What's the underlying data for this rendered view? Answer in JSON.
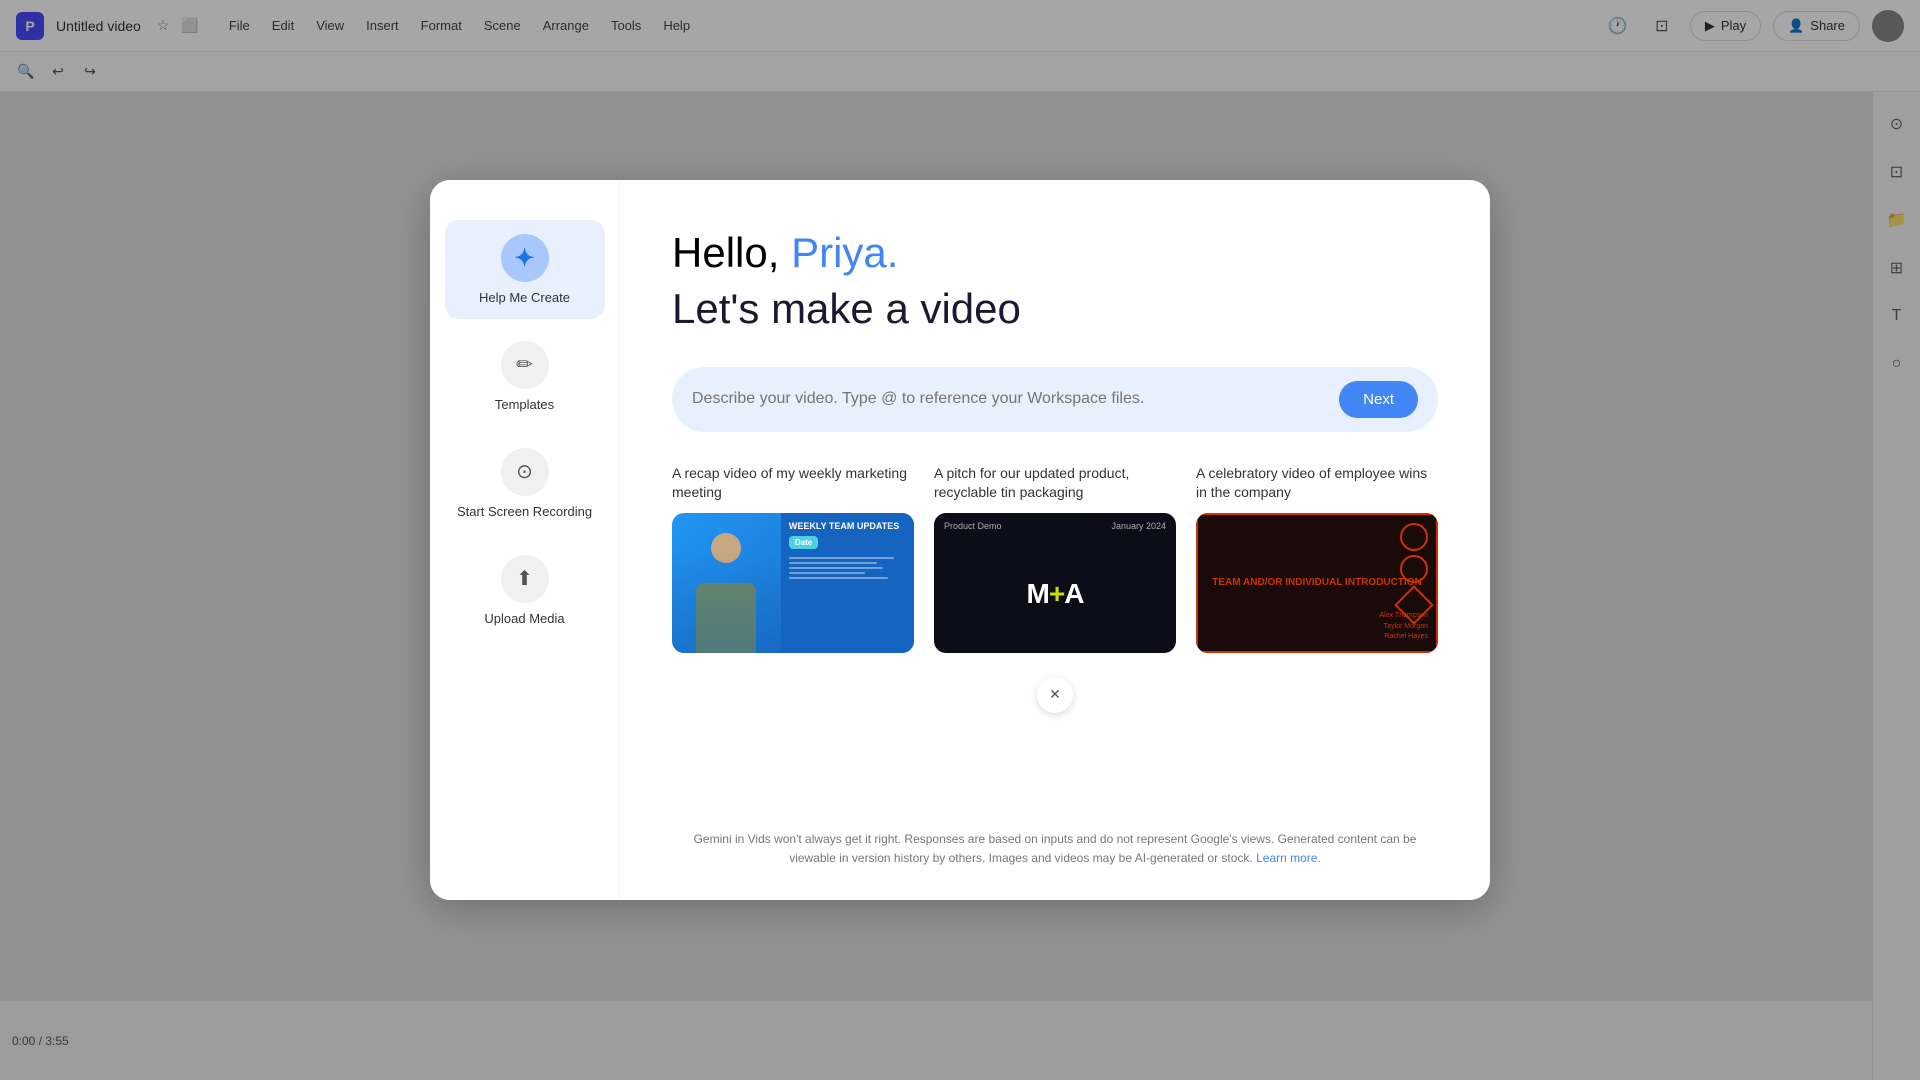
{
  "app": {
    "logo_letter": "P",
    "title": "Untitled video",
    "menu_items": [
      "File",
      "Edit",
      "View",
      "Insert",
      "Format",
      "Scene",
      "Arrange",
      "Tools",
      "Help"
    ],
    "play_label": "Play",
    "share_label": "Share",
    "time_display": "0:00 / 3:55"
  },
  "modal": {
    "greeting_hello": "Hello, ",
    "greeting_name": "Priya.",
    "greeting_subtitle": "Let's make a video",
    "input_placeholder": "Describe your video. Type @ to reference your Workspace files.",
    "next_button": "Next",
    "sidebar": {
      "items": [
        {
          "id": "help-me-create",
          "label": "Help Me Create",
          "icon": "✦",
          "active": true
        },
        {
          "id": "templates",
          "label": "Templates",
          "icon": "✏",
          "active": false
        },
        {
          "id": "start-screen-recording",
          "label": "Start Screen Recording",
          "icon": "⊙",
          "active": false
        },
        {
          "id": "upload-media",
          "label": "Upload Media",
          "icon": "⬆",
          "active": false
        }
      ]
    },
    "suggestions": [
      {
        "text": "A recap video of my weekly marketing meeting",
        "thumb_type": "weekly_team",
        "thumb_title": "WEEKLY TEAM UPDATES",
        "thumb_date": "Date"
      },
      {
        "text": "A pitch for our updated product, recyclable tin packaging",
        "thumb_type": "ma_product",
        "thumb_header_left": "Product Demo",
        "thumb_header_right": "January 2024",
        "thumb_logo": "M+A"
      },
      {
        "text": "A celebratory video of employee wins in the company",
        "thumb_type": "team_intro",
        "thumb_title": "TEAM AND/OR INDIVIDUAL INTRODUCTION",
        "thumb_names": "Alex Thompson\nTaylor Morgan\nRachel Hayes"
      }
    ],
    "disclaimer": "Gemini in Vids won't always get it right. Responses are based on inputs and do not represent Google's views. Generated content can be viewable in version history by others. Images and videos may be AI-generated or stock.",
    "learn_more": "Learn more."
  }
}
